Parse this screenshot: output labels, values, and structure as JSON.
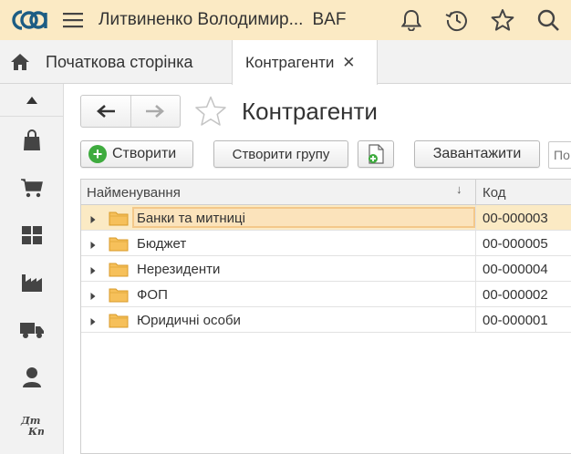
{
  "topbar": {
    "user": "Литвиненко Володимир...",
    "product": "BAF",
    "icons": [
      "bell-icon",
      "history-icon",
      "star-icon",
      "search-icon"
    ]
  },
  "tabs": {
    "home_label": "Початкова сторінка",
    "active_label": "Контрагенти",
    "close_glyph": "✕"
  },
  "sidebar": {
    "items": [
      "sales-icon",
      "purchases-icon",
      "warehouse-icon",
      "production-icon",
      "delivery-icon",
      "personnel-icon",
      "accounting-icon"
    ]
  },
  "form": {
    "title": "Контрагенти",
    "create_label": "Створити",
    "create_group_label": "Створити групу",
    "load_label": "Завантажити",
    "search_placeholder": "По"
  },
  "table": {
    "columns": [
      "Найменування",
      "Код"
    ],
    "sort_glyph": "↓",
    "rows": [
      {
        "name": "Банки та митниці",
        "code": "00-000003",
        "selected": true
      },
      {
        "name": "Бюджет",
        "code": "00-000005",
        "selected": false
      },
      {
        "name": "Нерезиденти",
        "code": "00-000004",
        "selected": false
      },
      {
        "name": "ФОП",
        "code": "00-000002",
        "selected": false
      },
      {
        "name": "Юридичні особи",
        "code": "00-000001",
        "selected": false
      }
    ]
  },
  "colors": {
    "accent": "#fbeac4",
    "selection_border": "#f3c88a",
    "create_green": "#3eab3e"
  }
}
